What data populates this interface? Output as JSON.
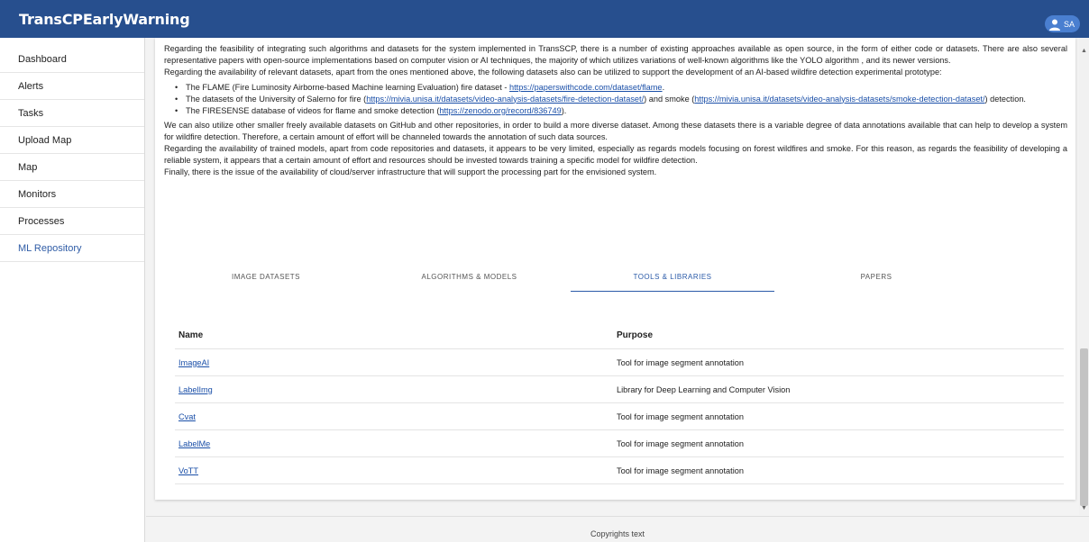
{
  "app": {
    "title": "TransCPEarlyWarning"
  },
  "user": {
    "initials": "SA",
    "icon": "person-icon"
  },
  "sidebar": {
    "items": [
      {
        "label": "Dashboard"
      },
      {
        "label": "Alerts"
      },
      {
        "label": "Tasks"
      },
      {
        "label": "Upload Map"
      },
      {
        "label": "Map"
      },
      {
        "label": "Monitors"
      },
      {
        "label": "Processes"
      },
      {
        "label": "ML Repository"
      }
    ],
    "active_index": 7
  },
  "content": {
    "p1": "Regarding the feasibility of integrating such algorithms and datasets for the system implemented in TransSCP, there is a number of existing approaches available as open source, in the form of either code or datasets. There are also several representative papers with open-source implementations based on computer vision or AI techniques, the majority of which utilizes variations of well-known algorithms like the YOLO algorithm , and its newer versions.",
    "p2": "Regarding the availability of relevant datasets, apart from the ones mentioned above, the following datasets also can be utilized to support the development of an AI-based wildfire detection experimental prototype:",
    "bullet1_text": "The FLAME (Fire Luminosity Airborne-based Machine learning Evaluation) fire dataset - ",
    "bullet1_link": "https://paperswithcode.com/dataset/flame",
    "bullet1_end": ".",
    "bullet2_text": "The datasets of the University of Salerno for fire (",
    "bullet2_link1": "https://mivia.unisa.it/datasets/video-analysis-datasets/fire-detection-dataset/",
    "bullet2_mid": ") and smoke (",
    "bullet2_link2": "https://mivia.unisa.it/datasets/video-analysis-datasets/smoke-detection-dataset/",
    "bullet2_end": ") detection.",
    "bullet3_text": "The FIRESENSE database of videos for flame and smoke detection (",
    "bullet3_link": "https://zenodo.org/record/836749",
    "bullet3_end": ").",
    "p3": "We can also utilize other smaller freely available datasets on GitHub and other repositories, in order to build a more diverse dataset. Among these datasets there is a variable degree of data annotations available that can help to develop a system for wildfire detection. Therefore, a certain amount of effort will be channeled towards the annotation of such data sources.",
    "p4": "Regarding the availability of trained models, apart from code repositories and datasets, it appears to be very limited, especially as regards models focusing on forest wildfires and smoke. For this reason, as regards the feasibility of developing a reliable system, it appears that a certain amount of effort and resources should be invested towards training a specific model for wildfire detection.",
    "p5": "Finally, there is the issue of the availability of cloud/server infrastructure that will support the processing part for the envisioned system."
  },
  "tabs": {
    "items": [
      {
        "label": "IMAGE DATASETS"
      },
      {
        "label": "ALGORITHMS & MODELS"
      },
      {
        "label": "TOOLS & LIBRARIES"
      },
      {
        "label": "PAPERS"
      }
    ],
    "active_index": 2
  },
  "table": {
    "headers": {
      "name": "Name",
      "purpose": "Purpose"
    },
    "rows": [
      {
        "name": "ImageAI",
        "purpose": "Tool for image segment annotation"
      },
      {
        "name": "LabelImg",
        "purpose": "Library for Deep Learning and Computer Vision"
      },
      {
        "name": "Cvat",
        "purpose": "Tool for image segment annotation"
      },
      {
        "name": "LabelMe",
        "purpose": "Tool for image segment annotation"
      },
      {
        "name": "VoTT",
        "purpose": "Tool for image segment annotation"
      }
    ]
  },
  "footer": {
    "text": "Copyrights text"
  },
  "colors": {
    "header": "#274f8e",
    "accent": "#2a5aa8",
    "link": "#1a4fa8"
  }
}
